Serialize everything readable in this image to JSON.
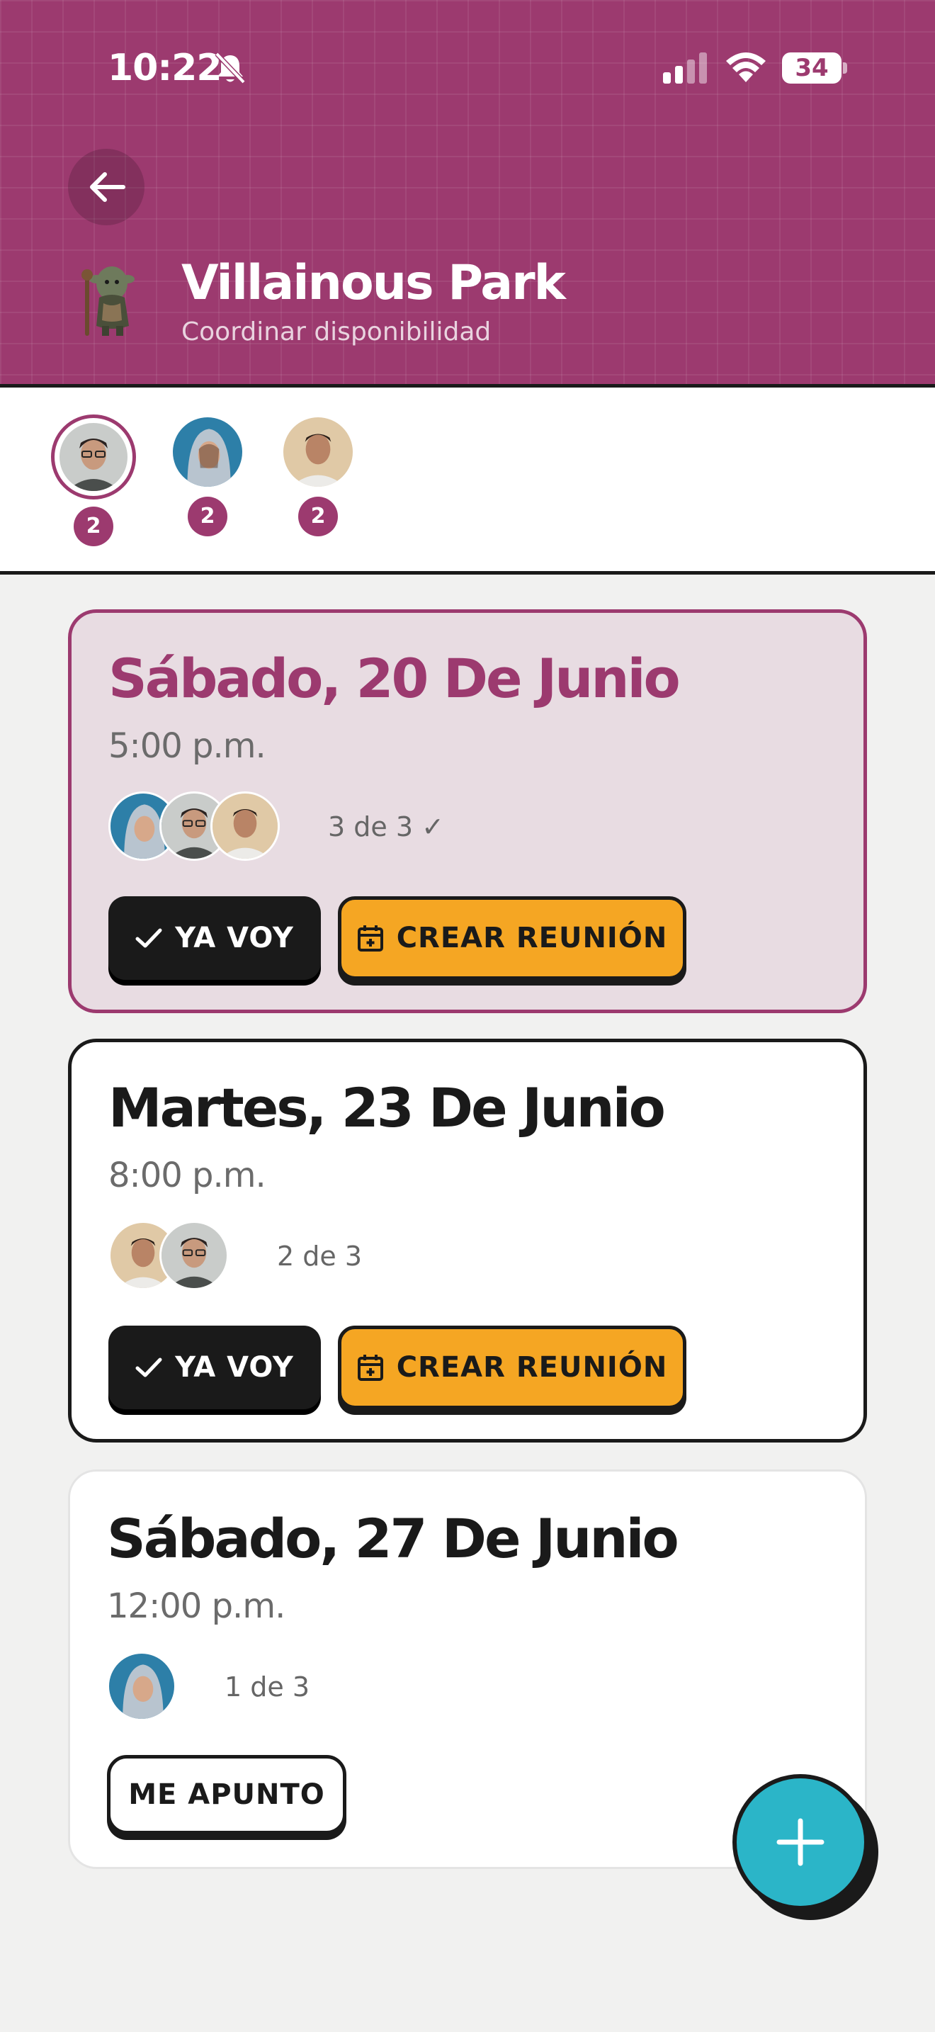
{
  "status_bar": {
    "time": "10:22",
    "battery": "34"
  },
  "header": {
    "title": "Villainous Park",
    "subtitle": "Coordinar disponibilidad",
    "colors": {
      "brand": "#9c3a6f"
    }
  },
  "members": [
    {
      "count": "2",
      "selected": true
    },
    {
      "count": "2",
      "selected": false
    },
    {
      "count": "2",
      "selected": false
    }
  ],
  "slots": [
    {
      "date": "Sábado, 20 De Junio",
      "time": "5:00 p.m.",
      "count": "3 de 3 ✓",
      "primary_label": "YA VOY",
      "secondary_label": "CREAR REUNIÓN"
    },
    {
      "date": "Martes, 23 De Junio",
      "time": "8:00 p.m.",
      "count": "2 de 3",
      "primary_label": "YA VOY",
      "secondary_label": "CREAR REUNIÓN"
    },
    {
      "date": "Sábado, 27 De Junio",
      "time": "12:00 p.m.",
      "count": "1 de 3",
      "primary_label": "ME APUNTO"
    }
  ],
  "icons": {
    "back": "arrow-left-icon",
    "check": "check-icon",
    "calendar": "calendar-plus-icon",
    "fab": "plus-icon"
  }
}
